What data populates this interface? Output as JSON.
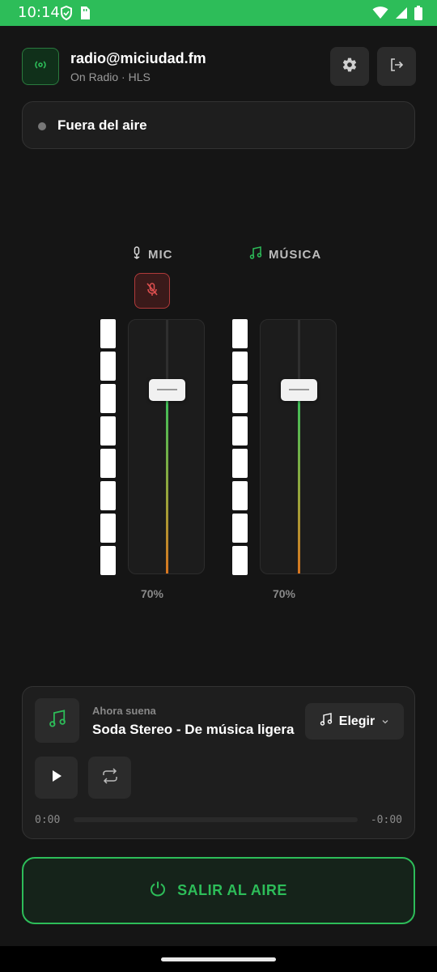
{
  "status_bar": {
    "time": "10:14",
    "icons_left": [
      "shield-icon",
      "sim-card-icon"
    ],
    "icons_right": [
      "wifi-icon",
      "signal-icon",
      "battery-icon"
    ],
    "color": "#2dbd59"
  },
  "header": {
    "logo_icon": "broadcast-icon",
    "user": "radio@miciudad.fm",
    "subtitle": "On Radio · HLS",
    "settings_icon": "gear-icon",
    "logout_icon": "logout-icon"
  },
  "status": {
    "label": "Fuera del aire",
    "indicator_color": "#777777"
  },
  "mixer": {
    "channels": [
      {
        "id": "mic",
        "label": "MIC",
        "icon": "mic-icon",
        "level_percent": 70,
        "level_label": "70%",
        "muted": true
      },
      {
        "id": "music",
        "label": "MÚSICA",
        "icon": "music-note-icon",
        "level_percent": 70,
        "level_label": "70%",
        "muted": false
      }
    ]
  },
  "player": {
    "now_label": "Ahora suena",
    "track_title": "Soda Stereo - De música ligera",
    "choose_label": "Elegir",
    "time_elapsed": "0:00",
    "time_remaining": "-0:00",
    "progress": 0
  },
  "go_live": {
    "label": "SALIR AL AIRE",
    "color": "#2dbd59"
  }
}
